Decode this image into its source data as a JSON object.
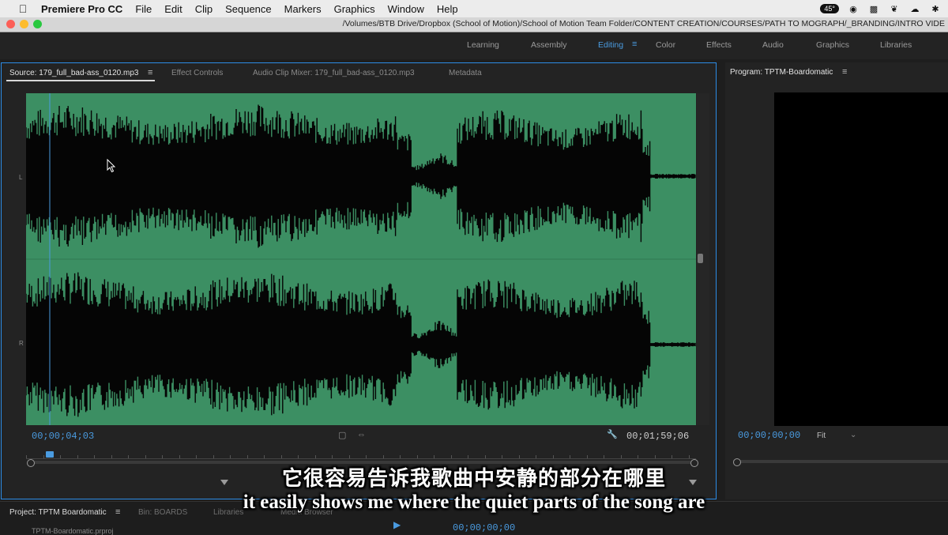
{
  "menubar": {
    "app_name": "Premiere Pro CC",
    "items": [
      "File",
      "Edit",
      "Clip",
      "Sequence",
      "Markers",
      "Graphics",
      "Window",
      "Help"
    ],
    "temp_badge": "45°"
  },
  "titlebar": {
    "path": "/Volumes/BTB Drive/Dropbox (School of Motion)/School of Motion Team Folder/CONTENT CREATION/COURSES/PATH TO MOGRAPH/_BRANDING/INTRO VIDE"
  },
  "workspaces": {
    "items": [
      "Learning",
      "Assembly",
      "Editing",
      "Color",
      "Effects",
      "Audio",
      "Graphics",
      "Libraries"
    ],
    "active": "Editing"
  },
  "source_panel": {
    "tabs": [
      "Source: 179_full_bad-ass_0120.mp3",
      "Effect Controls",
      "Audio Clip Mixer: 179_full_bad-ass_0120.mp3",
      "Metadata"
    ],
    "channel_left": "L",
    "channel_right": "R",
    "current_timecode": "00;00;04;03",
    "duration_timecode": "00;01;59;06",
    "waveform_color": "#3c8f63"
  },
  "program_panel": {
    "title": "Program: TPTM-Boardomatic",
    "timecode": "00;00;00;00",
    "fit_label": "Fit"
  },
  "project_panel": {
    "title": "Project: TPTM Boardomatic",
    "tabs": [
      "Bin: BOARDS",
      "Libraries",
      "Media Browser"
    ],
    "item": "TPTM-Boardomatic.prproj",
    "sequence_timecode": "00;00;00;00"
  },
  "subtitles": {
    "zh": "它很容易告诉我歌曲中安静的部分在哪里",
    "en": "it easily shows me where the quiet parts of the song are"
  },
  "colors": {
    "accent": "#4a9be0",
    "waveform_bg": "#3c8f63"
  }
}
